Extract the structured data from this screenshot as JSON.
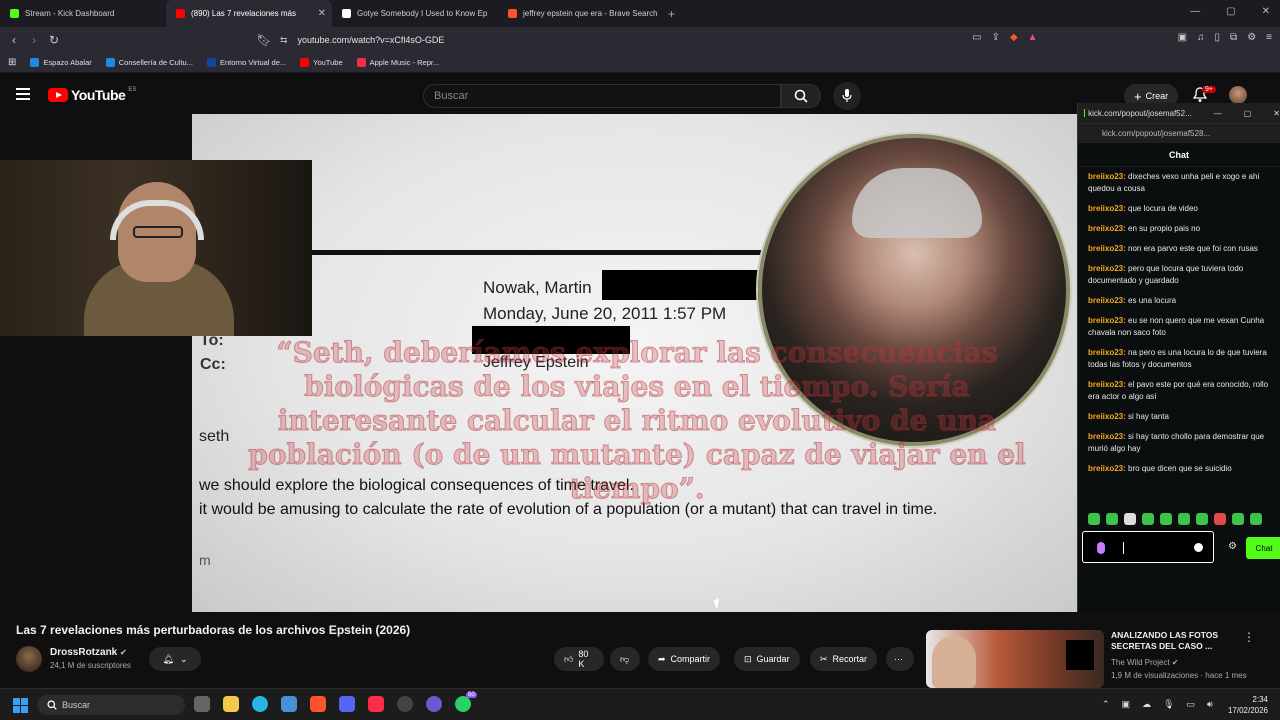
{
  "browser": {
    "tabs": [
      {
        "label": "Stream - Kick Dashboard",
        "color": "#53fc18"
      },
      {
        "label": "(890) Las 7 revelaciones más",
        "color": "#ff0000"
      },
      {
        "label": "Gotye Somebody I Used to Know Ep",
        "color": "#ffffff"
      },
      {
        "label": "jeffrey epstein que era - Brave Search",
        "color": "#fb542b"
      }
    ],
    "url": "youtube.com/watch?v=xCfl4sO-GDE",
    "bookmarks": [
      {
        "label": "Espazo Abalar",
        "color": "#1e88e5"
      },
      {
        "label": "Consellería de Cultu...",
        "color": "#1e88e5"
      },
      {
        "label": "Entorno Virtual de...",
        "color": "#0d47a1"
      },
      {
        "label": "YouTube",
        "color": "#ff0000"
      },
      {
        "label": "Apple Music - Repr...",
        "color": "#fa2d48"
      }
    ]
  },
  "youtube": {
    "logo_text": "YouTube",
    "region_badge": "ES",
    "search_placeholder": "Buscar",
    "create_label": "Crear",
    "notif_count": "9+"
  },
  "video_frame": {
    "from_line": "Nowak, Martin",
    "date_line": "Monday, June 20, 2011 1:57 PM",
    "to_label": "To:",
    "cc_label": "Cc:",
    "cc_value": "Jeffrey Epstein",
    "greeting": "seth",
    "line1": "we should explore the biological consequences of time travel.",
    "line2": "it would be amusing to calculate the rate of evolution of a population (or a mutant) that can travel in time.",
    "sign": "m",
    "overlay_quote": "“Seth, deberíamos explorar las consecuencias biológicas de los viajes en el tiempo. Sería interesante calcular el ritmo evolutivo de una población (o de un mutante) capaz de viajar en el tiempo”."
  },
  "chat_window": {
    "window_title": "kick.com/popout/josemaf52...",
    "url": "kick.com/popout/josemaf528...",
    "header": "Chat",
    "messages": [
      {
        "user": "breiixo23:",
        "text": "dixeches vexo unha peli e xogo e ahi quedou a cousa"
      },
      {
        "user": "breiixo23:",
        "text": "que locura de video"
      },
      {
        "user": "breiixo23:",
        "text": "en su propio pais no"
      },
      {
        "user": "breiixo23:",
        "text": "non era parvo este que foi con rusas"
      },
      {
        "user": "breiixo23:",
        "text": "pero que locura que tuviera todo documentado y guardado"
      },
      {
        "user": "breiixo23:",
        "text": "es una locura"
      },
      {
        "user": "breiixo23:",
        "text": "eu se non quero que me vexan Cunha chavala non saco foto"
      },
      {
        "user": "breiixo23:",
        "text": "na pero es una locura lo de que tuviera todas las fotos y documentos"
      },
      {
        "user": "breiixo23:",
        "text": "el pavo este por qué era conocido, rollo era actor o algo así"
      },
      {
        "user": "breiixo23:",
        "text": "si hay tanta"
      },
      {
        "user": "breiixo23:",
        "text": "si hay tanto chollo para demostrar que murió algo hay"
      },
      {
        "user": "breiixo23:",
        "text": "bro que dicen que se suicidio"
      }
    ],
    "send_label": "Chat",
    "accent": "#53fc18"
  },
  "video_info": {
    "title": "Las 7 revelaciones más perturbadoras de los archivos Epstein (2026)",
    "channel": "DrossRotzank",
    "subscribers": "24,1 M de suscriptores",
    "likes": "80 K",
    "share_label": "Compartir",
    "save_label": "Guardar",
    "clip_label": "Recortar"
  },
  "recommended": {
    "title": "ANALIZANDO LAS FOTOS SECRETAS DEL CASO ...",
    "channel": "The Wild Project",
    "meta": "1,9 M de visualizaciones · hace 1 mes"
  },
  "taskbar": {
    "search_placeholder": "Buscar",
    "time": "2:34",
    "date": "17/02/2026",
    "discord_badge": "50"
  }
}
